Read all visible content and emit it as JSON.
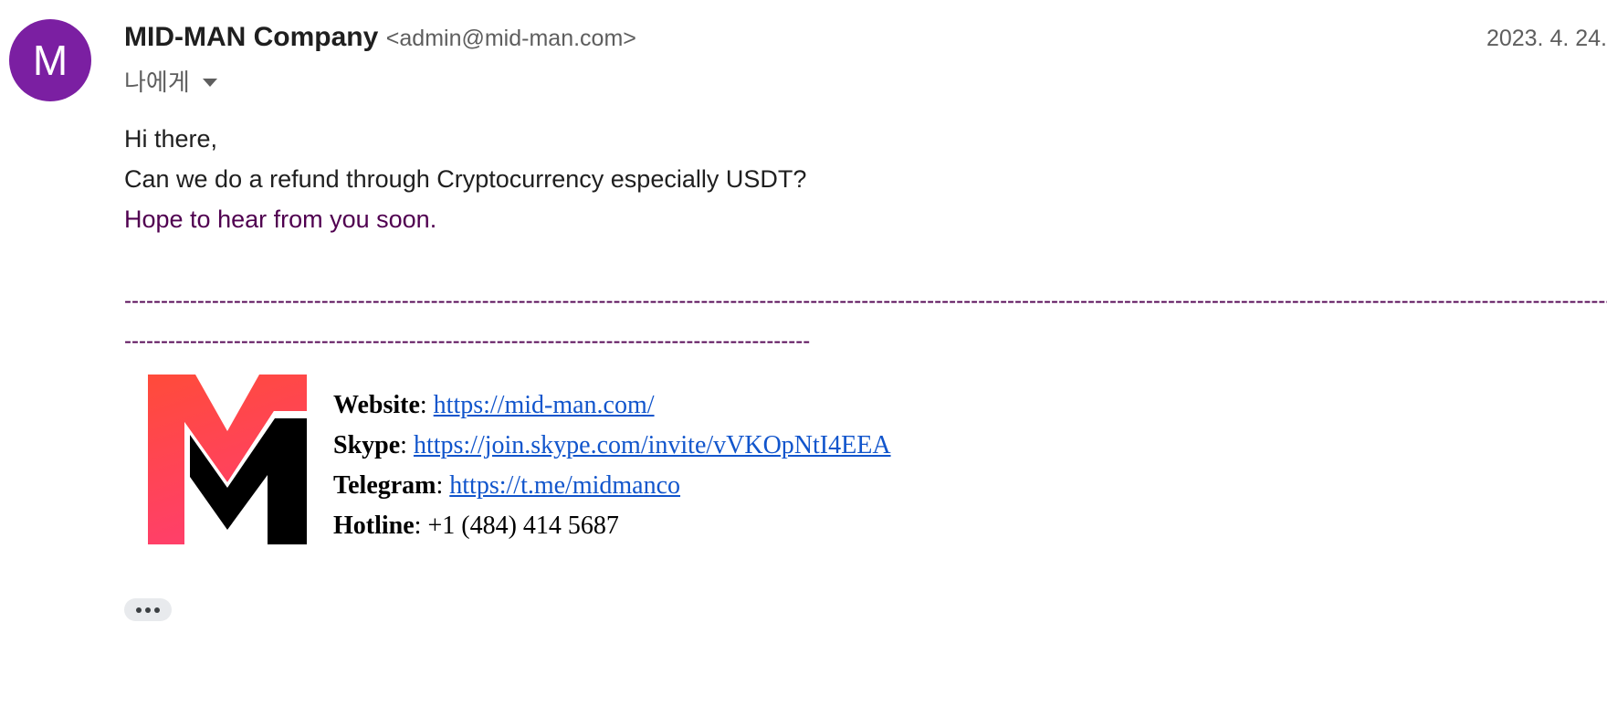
{
  "avatar": {
    "letter": "M",
    "color": "#7b1fa2"
  },
  "sender": {
    "name": "MID-MAN Company",
    "email": "<admin@mid-man.com>"
  },
  "date": "2023. 4. 24.",
  "recipient": {
    "label": "나에게",
    "icon": "caret-down-icon"
  },
  "body": {
    "lines": [
      "Hi there,",
      "Can we do a refund through Cryptocurrency especially USDT?",
      "Hope to hear from you soon."
    ],
    "divider_line_1": "--------------------------------------------------------------------------------------------------------------------------------------------------------------------------------------------------------------------------------------------------------------------",
    "divider_line_2": "----------------------------------------------------------------------------------------------"
  },
  "signature": {
    "logo": {
      "icon": "mid-man-logo",
      "colors": [
        "#ff4b3a",
        "#ff3f6b",
        "#000000"
      ]
    },
    "website": {
      "label": "Website",
      "separator": ": ",
      "value": "https://mid-man.com/"
    },
    "skype": {
      "label": "Skype",
      "separator": ": ",
      "value": "https://join.skype.com/invite/vVKOpNtI4EEA"
    },
    "telegram": {
      "label": "Telegram",
      "separator": ": ",
      "value": "https://t.me/midmanco"
    },
    "hotline": {
      "label": "Hotline",
      "separator": ": ",
      "value": "+1 (484) 414 5687"
    }
  },
  "actions": {
    "more_icon": "ellipsis-icon"
  },
  "colors": {
    "link": "#1155cc",
    "quoted_purple": "#500050",
    "muted": "#5e5e5e"
  }
}
